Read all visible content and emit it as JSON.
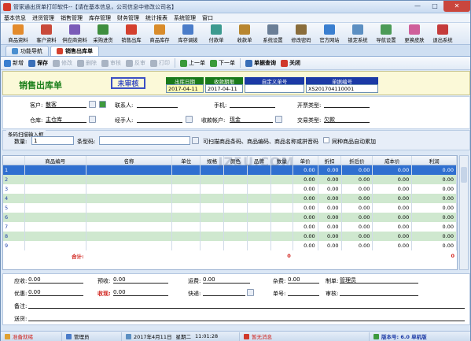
{
  "window": {
    "title": "管家通出货单打印软件--【请在基本信息，公司信息中修改公司名】"
  },
  "menu": [
    "基本信息",
    "进货管理",
    "销售管理",
    "库存管理",
    "财务管理",
    "统计报表",
    "系统管理",
    "窗口"
  ],
  "toolbar": [
    {
      "label": "商品资料",
      "icon": "goods-icon",
      "color": "#e38b2c"
    },
    {
      "label": "客户资料",
      "icon": "customer-icon",
      "color": "#c94a3a"
    },
    {
      "label": "供应商资料",
      "icon": "supplier-icon",
      "color": "#7a5bb8"
    },
    {
      "label": "采购进货",
      "icon": "purchase-icon",
      "color": "#3e8e3e"
    },
    {
      "label": "销售出库",
      "icon": "sales-out-icon",
      "color": "#d4402e"
    },
    {
      "label": "商品库存",
      "icon": "stock-icon",
      "color": "#d98c2a"
    },
    {
      "label": "库存调拨",
      "icon": "transfer-icon",
      "color": "#4a7cc9"
    },
    {
      "label": "付款单",
      "icon": "payment-icon",
      "color": "#3c9a8f"
    },
    {
      "label": "收款单",
      "icon": "receipt-icon",
      "color": "#b8862f"
    },
    {
      "label": "系统设置",
      "icon": "settings-icon",
      "color": "#6a7e96"
    },
    {
      "label": "修改密码",
      "icon": "password-icon",
      "color": "#8a6d3b"
    },
    {
      "label": "官方网站",
      "icon": "website-icon",
      "color": "#3a7fd0"
    },
    {
      "label": "锁定系统",
      "icon": "lock-icon",
      "color": "#5c8fc2"
    },
    {
      "label": "导航设置",
      "icon": "nav-settings-icon",
      "color": "#4c9b57"
    },
    {
      "label": "更换皮肤",
      "icon": "skin-icon",
      "color": "#cf5f9a"
    },
    {
      "label": "退出系统",
      "icon": "exit-icon",
      "color": "#c53b3b"
    }
  ],
  "tabs": [
    {
      "label": "功能导航",
      "active": false
    },
    {
      "label": "销售出库单",
      "active": true
    }
  ],
  "actions": [
    {
      "label": "新增",
      "disabled": false,
      "bold": false,
      "color": "#3a7fd0"
    },
    {
      "label": "保存",
      "disabled": false,
      "bold": true,
      "color": "#3a6fb8"
    },
    {
      "label": "修改",
      "disabled": true,
      "bold": false,
      "color": "#a9b4c3"
    },
    {
      "label": "删除",
      "disabled": true,
      "bold": false,
      "color": "#a9b4c3"
    },
    {
      "label": "审核",
      "disabled": true,
      "bold": false,
      "color": "#a9b4c3"
    },
    {
      "label": "反审",
      "disabled": true,
      "bold": false,
      "color": "#a9b4c3"
    },
    {
      "label": "打印",
      "disabled": true,
      "bold": false,
      "color": "#a9b4c3"
    },
    {
      "label": "上一单",
      "disabled": false,
      "bold": false,
      "color": "#3a9a3a"
    },
    {
      "label": "下一单",
      "disabled": false,
      "bold": false,
      "color": "#3a9a3a"
    },
    {
      "label": "单据查询",
      "disabled": false,
      "bold": true,
      "color": "#3a6fb8"
    },
    {
      "label": "关闭",
      "disabled": false,
      "bold": true,
      "color": "#d0392b"
    }
  ],
  "header": {
    "doc_title": "销售出库单",
    "stamp": "未审核",
    "fields": [
      {
        "label": "出库日期",
        "value": "2017-04-11",
        "head": "green",
        "yellow": true
      },
      {
        "label": "收款期限",
        "value": "2017-04-11",
        "head": "green",
        "yellow": false
      },
      {
        "label": "自定义单号",
        "value": "",
        "head": "blue",
        "yellow": false
      },
      {
        "label": "单据编号",
        "value": "XS201704110001",
        "head": "blue",
        "yellow": false
      }
    ]
  },
  "form": {
    "customer_label": "客户:",
    "customer_value": "散客",
    "contact_label": "联系人:",
    "contact_value": "",
    "phone_label": "手机:",
    "phone_value": "",
    "invoice_label": "开票类型:",
    "invoice_value": "",
    "warehouse_label": "仓库:",
    "warehouse_value": "主仓库",
    "handler_label": "经手人:",
    "handler_value": "",
    "account_label": "收款帐户:",
    "account_value": "现金",
    "trade_label": "交易类型:",
    "trade_value": "欠款"
  },
  "scan": {
    "caption": "条码扫描输入框",
    "qty_label": "数量:",
    "qty_value": "1",
    "barcode_label": "条型码:",
    "barcode_value": "",
    "hint": "可扫描商品条码、商品编码、商品名称或拼音码",
    "checkbox_label": "同种商品自动累加"
  },
  "grid": {
    "columns": [
      "",
      "商品编号",
      "名称",
      "单位",
      "规格",
      "颜色",
      "品牌",
      "数量",
      "单价",
      "折扣",
      "折后价",
      "成本价",
      "利润"
    ],
    "rows": [
      {
        "n": "1",
        "qty": "",
        "price": "0.00",
        "disc": "0.00",
        "after": "0.00",
        "cost": "0.00",
        "profit": "0.00"
      },
      {
        "n": "2",
        "qty": "",
        "price": "0.00",
        "disc": "0.00",
        "after": "0.00",
        "cost": "0.00",
        "profit": "0.00"
      },
      {
        "n": "3",
        "qty": "",
        "price": "0.00",
        "disc": "0.00",
        "after": "0.00",
        "cost": "0.00",
        "profit": "0.00"
      },
      {
        "n": "4",
        "qty": "",
        "price": "0.00",
        "disc": "0.00",
        "after": "0.00",
        "cost": "0.00",
        "profit": "0.00"
      },
      {
        "n": "5",
        "qty": "",
        "price": "0.00",
        "disc": "0.00",
        "after": "0.00",
        "cost": "0.00",
        "profit": "0.00"
      },
      {
        "n": "6",
        "qty": "",
        "price": "0.00",
        "disc": "0.00",
        "after": "0.00",
        "cost": "0.00",
        "profit": "0.00"
      },
      {
        "n": "7",
        "qty": "",
        "price": "0.00",
        "disc": "0.00",
        "after": "0.00",
        "cost": "0.00",
        "profit": "0.00"
      },
      {
        "n": "8",
        "qty": "",
        "price": "0.00",
        "disc": "0.00",
        "after": "0.00",
        "cost": "0.00",
        "profit": "0.00"
      },
      {
        "n": "9",
        "qty": "",
        "price": "0.00",
        "disc": "0.00",
        "after": "0.00",
        "cost": "0.00",
        "profit": "0.00"
      }
    ],
    "total_label": "合计:",
    "total_qty": "0",
    "total_profit": "0"
  },
  "footer": {
    "receivable_label": "应收:",
    "receivable_value": "0.00",
    "prepaid_label": "预收:",
    "prepaid_value": "0.00",
    "freight_label": "运费:",
    "freight_value": "0.00",
    "misc_label": "杂费:",
    "misc_value": "0.00",
    "maker_label": "制单:",
    "maker_value": "管理员",
    "discount_label": "优惠:",
    "discount_value": "0.00",
    "received_label": "收现:",
    "received_value": "0.00",
    "express_label": "快递:",
    "express_value": "",
    "waybill_label": "单号:",
    "waybill_value": "",
    "auditor_label": "审核:",
    "auditor_value": "",
    "remark_label": "备注:",
    "remark_value": "",
    "address_label": "送货:",
    "address_value": ""
  },
  "status": {
    "ready": "准备就绪",
    "user": "管理员",
    "date": "2017年4月11日",
    "weekday": "星期二",
    "time": "11:01:28",
    "message": "暂无消息",
    "version": "版本号: 6.0 单机版"
  },
  "watermark": "JZ5U.COM"
}
